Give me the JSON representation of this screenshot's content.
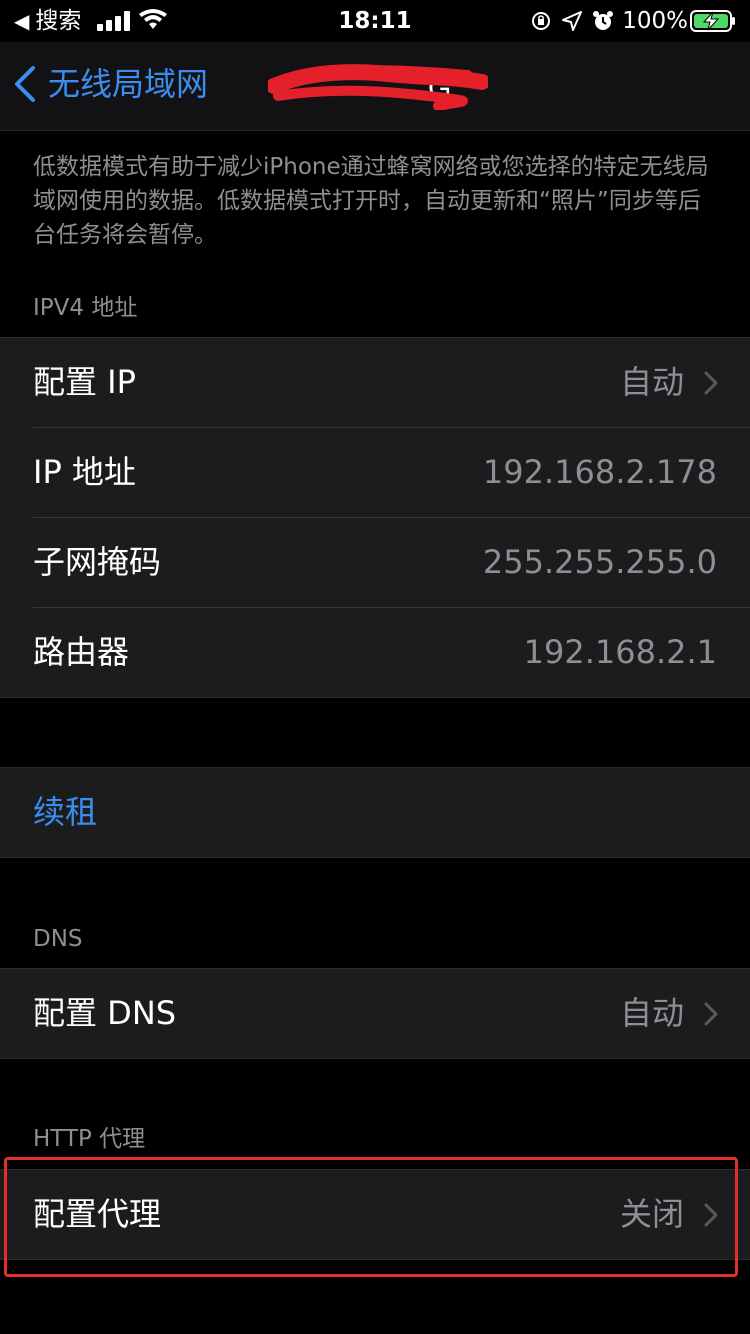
{
  "status_bar": {
    "back_label": "搜索",
    "time": "18:11",
    "battery_percent": "100%"
  },
  "nav": {
    "back_label": "无线局域网",
    "title_suffix": "G"
  },
  "low_data_footer": "低数据模式有助于减少iPhone通过蜂窝网络或您选择的特定无线局域网使用的数据。低数据模式打开时，自动更新和“照片”同步等后台任务将会暂停。",
  "ipv4": {
    "header": "IPV4 地址",
    "rows": [
      {
        "label": "配置 IP",
        "value": "自动"
      },
      {
        "label": "IP 地址",
        "value": "192.168.2.178"
      },
      {
        "label": "子网掩码",
        "value": "255.255.255.0"
      },
      {
        "label": "路由器",
        "value": "192.168.2.1"
      }
    ]
  },
  "renew": {
    "label": "续租"
  },
  "dns": {
    "header": "DNS",
    "rows": [
      {
        "label": "配置 DNS",
        "value": "自动"
      }
    ]
  },
  "http_proxy": {
    "header": "HTTP 代理",
    "rows": [
      {
        "label": "配置代理",
        "value": "关闭"
      }
    ]
  },
  "colors": {
    "accent": "#3b8ef0",
    "highlight": "#e0302a",
    "battery_charging": "#4cd964"
  }
}
